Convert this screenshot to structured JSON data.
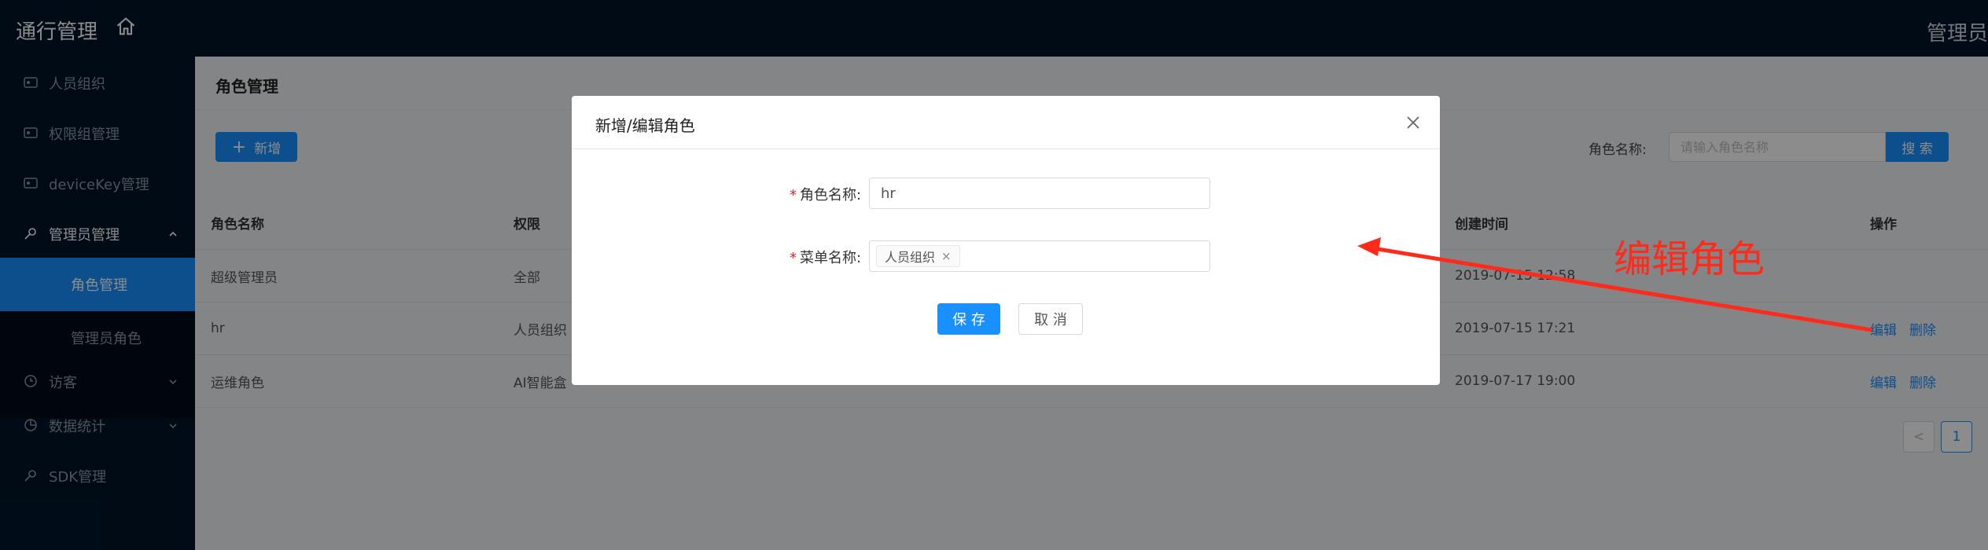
{
  "header": {
    "app_title": "通行管理",
    "admin_label": "管理员"
  },
  "sidebar": {
    "items": [
      {
        "label": "人员组织"
      },
      {
        "label": "权限组管理"
      },
      {
        "label": "deviceKey管理"
      },
      {
        "label": "管理员管理"
      },
      {
        "label": "访客"
      },
      {
        "label": "数据统计"
      },
      {
        "label": "SDK管理"
      }
    ],
    "subitems": [
      {
        "label": "角色管理"
      },
      {
        "label": "管理员角色"
      }
    ]
  },
  "page": {
    "title": "角色管理",
    "add_label": "新增",
    "search_label": "角色名称:",
    "search_placeholder": "请输入角色名称",
    "search_button": "搜 索"
  },
  "table": {
    "headers": [
      "角色名称",
      "权限",
      "创建时间",
      "操作"
    ],
    "rows": [
      {
        "name": "超级管理员",
        "perm": "全部",
        "time": "2019-07-15 12:58"
      },
      {
        "name": "hr",
        "perm": "人员组织",
        "time": "2019-07-15 17:21"
      },
      {
        "name": "运维角色",
        "perm": "AI智能盒",
        "time": "2019-07-17 19:00"
      }
    ],
    "action_edit": "编辑",
    "action_delete": "删除"
  },
  "pager": {
    "prev": "<",
    "current": "1"
  },
  "modal": {
    "title": "新增/编辑角色",
    "role_label": "角色名称:",
    "role_value": "hr",
    "menu_label": "菜单名称:",
    "menu_tag": "人员组织",
    "tag_close": "×",
    "save": "保 存",
    "cancel": "取 消"
  },
  "annotation": {
    "text": "编辑角色",
    "color": "#ff2a1a"
  },
  "colors": {
    "header_bg": "#001529",
    "accent": "#1890ff"
  }
}
